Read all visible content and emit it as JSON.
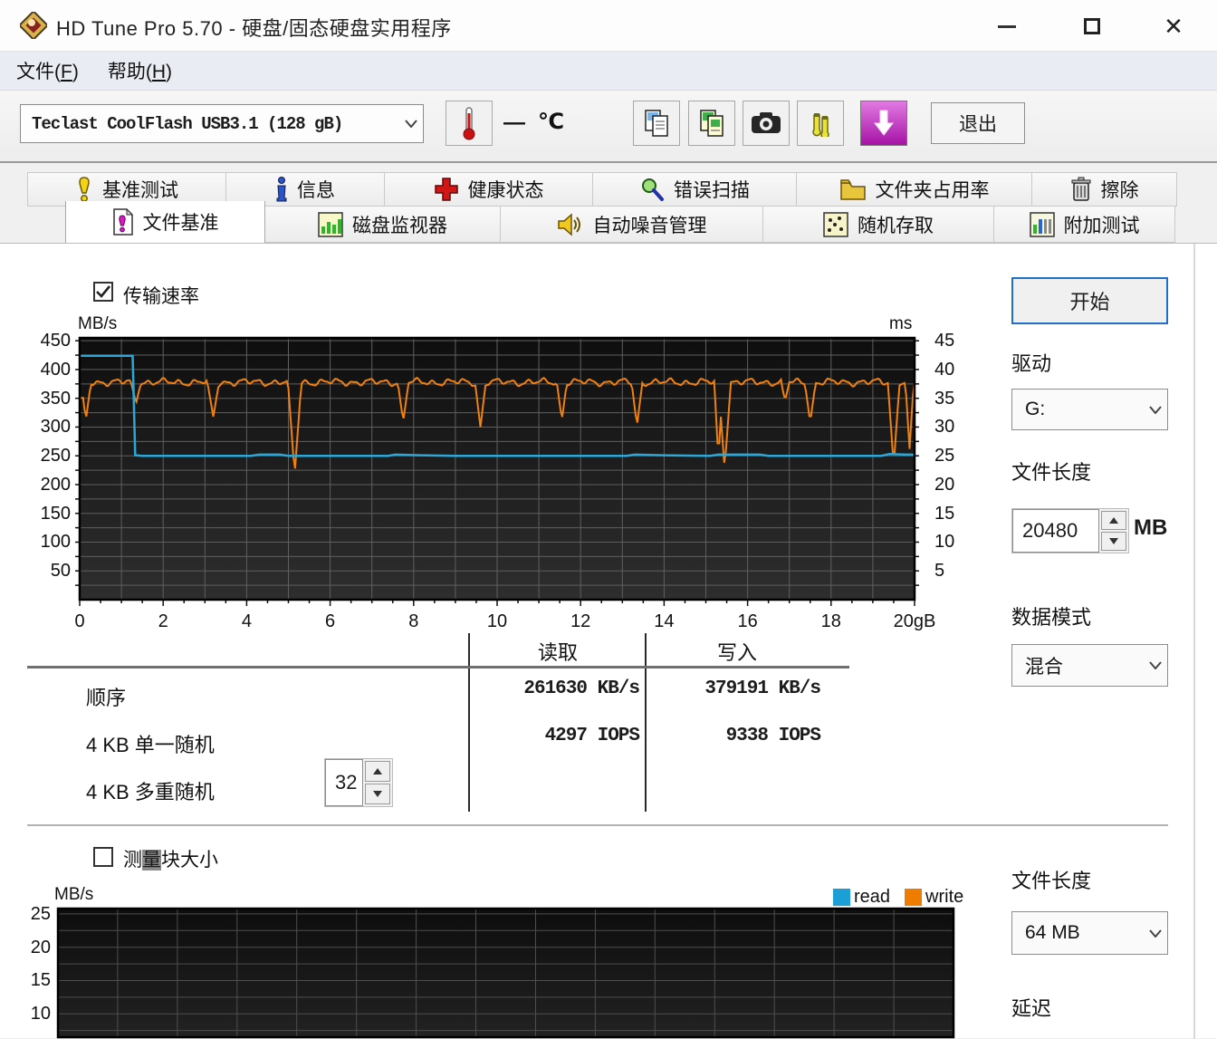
{
  "window": {
    "title": "HD Tune Pro 5.70 - 硬盘/固态硬盘实用程序"
  },
  "menu": {
    "file": {
      "pre": "文件(",
      "key": "F",
      "post": ")"
    },
    "help": {
      "pre": "帮助(",
      "key": "H",
      "post": ")"
    }
  },
  "toolbar": {
    "drive_selector_value": "Teclast CoolFlash USB3.1 (128 gB)",
    "temp_value": "—",
    "temp_unit": "℃",
    "icons": [
      "copy-text-icon",
      "copy-image-icon",
      "camera-icon",
      "audio-icon",
      "download-icon"
    ],
    "exit_label": "退出"
  },
  "tabs": {
    "row1": [
      {
        "label": "基准测试",
        "icon": "benchmark-icon"
      },
      {
        "label": "信息",
        "icon": "info-icon"
      },
      {
        "label": "健康状态",
        "icon": "health-icon"
      },
      {
        "label": "错误扫描",
        "icon": "error-scan-icon"
      },
      {
        "label": "文件夹占用率",
        "icon": "folder-usage-icon"
      },
      {
        "label": "擦除",
        "icon": "erase-icon"
      }
    ],
    "row2": [
      {
        "label": "文件基准",
        "icon": "file-benchmark-icon",
        "active": true
      },
      {
        "label": "磁盘监视器",
        "icon": "disk-monitor-icon"
      },
      {
        "label": "自动噪音管理",
        "icon": "aam-icon"
      },
      {
        "label": "随机存取",
        "icon": "random-access-icon"
      },
      {
        "label": "附加测试",
        "icon": "extra-tests-icon"
      }
    ]
  },
  "panel": {
    "start_button": "开始",
    "drive_label": "驱动",
    "drive_value": "G:",
    "file_length_label": "文件长度",
    "file_length_value": "20480",
    "file_length_unit": "MB",
    "data_mode_label": "数据模式",
    "data_mode_value": "混合"
  },
  "transfer": {
    "checkbox_label": "传输速率",
    "checked": true
  },
  "results": {
    "read_header": "读取",
    "write_header": "写入",
    "rows": [
      {
        "label": "顺序",
        "read": "261630 KB/s",
        "write": "379191 KB/s"
      },
      {
        "label": "4 KB 单一随机",
        "read": "4297 IOPS",
        "write": "9338 IOPS"
      },
      {
        "label": "4 KB 多重随机",
        "spinner_value": "32"
      }
    ]
  },
  "block_test": {
    "checkbox_label": {
      "pre": "测",
      "hl": "量",
      "post": "块大小"
    },
    "checked": false,
    "file_length_label": "文件长度",
    "file_length_value": "64 MB",
    "latency_label": "延迟"
  },
  "chart_data": [
    {
      "type": "line",
      "title": "传输速率",
      "ylabel": "MB/s",
      "y2label": "ms",
      "xlim": [
        0,
        20
      ],
      "ylim": [
        0,
        455
      ],
      "y2lim": [
        0,
        45.5
      ],
      "x_tick_values": [
        0,
        2,
        4,
        6,
        8,
        10,
        12,
        14,
        16,
        18,
        20
      ],
      "x_tick_labels": [
        "0",
        "2",
        "4",
        "6",
        "8",
        "10",
        "12",
        "14",
        "16",
        "18",
        "20gB"
      ],
      "y_ticks": [
        450,
        400,
        350,
        300,
        250,
        200,
        150,
        100,
        50
      ],
      "y2_ticks": [
        45,
        40,
        35,
        30,
        25,
        20,
        15,
        10,
        5
      ],
      "grid": {
        "x_step": 1,
        "y_step": 25,
        "on": true
      },
      "legend_position": "none",
      "series": [
        {
          "name": "read",
          "color": "#2ba7d9",
          "points": [
            [
              0,
              424
            ],
            [
              1.27,
              424
            ],
            [
              1.33,
              251
            ],
            [
              1.5,
              250
            ],
            [
              4.1,
              250
            ],
            [
              4.3,
              252
            ],
            [
              4.8,
              252
            ],
            [
              5.0,
              250
            ],
            [
              7.4,
              250
            ],
            [
              7.55,
              252
            ],
            [
              8.2,
              251
            ],
            [
              9.0,
              250
            ],
            [
              13.1,
              250
            ],
            [
              13.3,
              252
            ],
            [
              14.0,
              251
            ],
            [
              15.1,
              250
            ],
            [
              15.3,
              252
            ],
            [
              16.3,
              252
            ],
            [
              16.5,
              250
            ],
            [
              19.2,
              250
            ],
            [
              19.4,
              253
            ],
            [
              19.8,
              252
            ],
            [
              20,
              252
            ]
          ]
        },
        {
          "name": "write",
          "color": "#f08111",
          "baseline": 378,
          "wave_amp": 7,
          "wave_period": 0.38,
          "dips": [
            [
              0.02,
              348,
              0.25
            ],
            [
              0.15,
              313,
              0.12
            ],
            [
              1.35,
              341,
              0.12
            ],
            [
              3.2,
              318,
              0.14
            ],
            [
              5.15,
              218,
              0.16
            ],
            [
              7.75,
              310,
              0.13
            ],
            [
              9.6,
              300,
              0.13
            ],
            [
              11.55,
              312,
              0.12
            ],
            [
              13.35,
              302,
              0.13
            ],
            [
              15.3,
              245,
              0.1
            ],
            [
              15.45,
              228,
              0.15
            ],
            [
              16.9,
              346,
              0.1
            ],
            [
              17.5,
              308,
              0.13
            ],
            [
              19.5,
              233,
              0.14
            ],
            [
              19.88,
              262,
              0.1
            ]
          ]
        }
      ]
    },
    {
      "type": "line",
      "title": "测量块大小",
      "ylabel": "MB/s",
      "ylim": [
        6.5,
        25.8
      ],
      "y_ticks": [
        25,
        20,
        15,
        10
      ],
      "grid": {
        "x_divisions": 15,
        "y_step": 2.5,
        "on": true
      },
      "legend_position": "top-right",
      "legend": [
        {
          "label": "read",
          "color": "#1b9fd4"
        },
        {
          "label": "write",
          "color": "#ee7c00"
        }
      ],
      "series": []
    }
  ]
}
